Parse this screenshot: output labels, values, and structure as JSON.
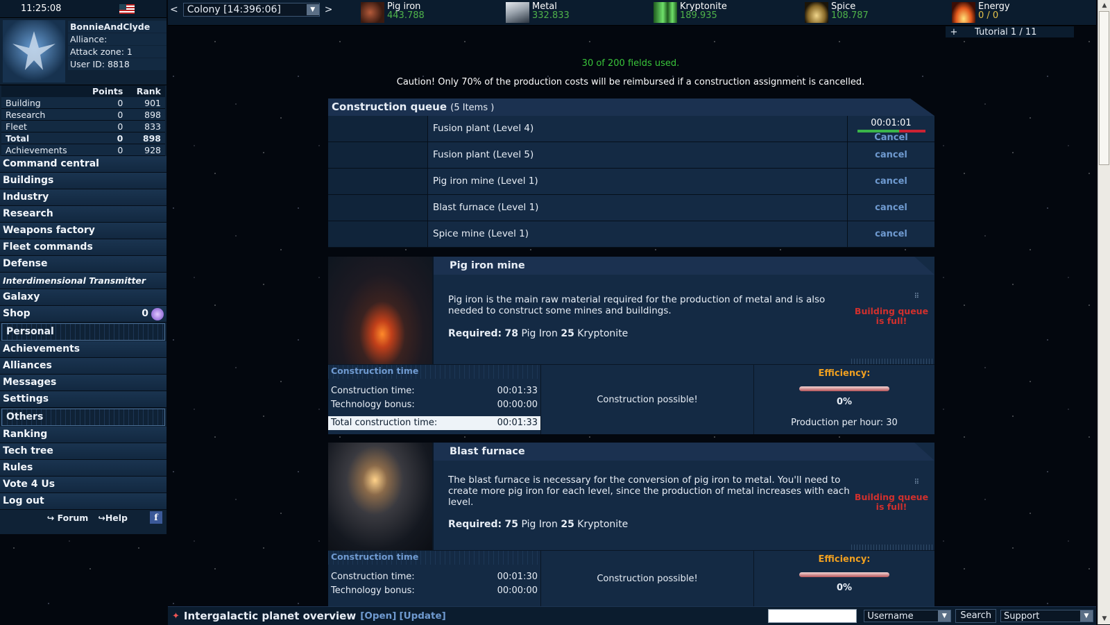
{
  "clock": "11:25:08",
  "player": {
    "name": "BonnieAndClyde",
    "alliance": "Alliance:",
    "attack_zone": "Attack zone: 1",
    "user_id": "User ID: 8818"
  },
  "stats": {
    "headers": [
      "Points",
      "Rank"
    ],
    "rows": [
      {
        "label": "Building",
        "points": "0",
        "rank": "901"
      },
      {
        "label": "Research",
        "points": "0",
        "rank": "898"
      },
      {
        "label": "Fleet",
        "points": "0",
        "rank": "833"
      },
      {
        "label": "Total",
        "points": "0",
        "rank": "898"
      },
      {
        "label": "Achievements",
        "points": "0",
        "rank": "928"
      }
    ]
  },
  "nav": {
    "main": [
      "Command central",
      "Buildings",
      "Industry",
      "Research",
      "Weapons factory",
      "Fleet commands",
      "Defense",
      "Interdimensional Transmitter",
      "Galaxy",
      "Shop"
    ],
    "shop_count": "0",
    "personal_label": "Personal",
    "personal": [
      "Achievements",
      "Alliances",
      "Messages",
      "Settings"
    ],
    "others_label": "Others",
    "others": [
      "Ranking",
      "Tech tree",
      "Rules",
      "Vote 4 Us",
      "Log out"
    ],
    "forum": "↪ Forum",
    "help": "↪Help",
    "facebook": "f"
  },
  "topbar": {
    "prev": "<",
    "next": ">",
    "colony": "Colony [14:396:06]",
    "resources": [
      {
        "name": "Pig iron",
        "value": "443.788",
        "icon": "pig-iron-icon"
      },
      {
        "name": "Metal",
        "value": "332.833",
        "icon": "metal-icon"
      },
      {
        "name": "Kryptonite",
        "value": "189.935",
        "icon": "kryptonite-icon"
      },
      {
        "name": "Spice",
        "value": "108.787",
        "icon": "spice-icon"
      },
      {
        "name": "Energy",
        "value": "0 / 0",
        "icon": "energy-icon"
      }
    ],
    "tutorial_plus": "+",
    "tutorial": "Tutorial 1 / 11"
  },
  "fields_used": "30 of 200 fields used.",
  "caution": "Caution! Only 70% of the production costs will be reimbursed if a construction assignment is cancelled.",
  "queue": {
    "title": "Construction queue",
    "count": "(5 Items )",
    "timer": "00:01:01",
    "progress": 0.62,
    "items": [
      {
        "name": "Fusion plant (Level 4)",
        "action": "Cancel"
      },
      {
        "name": "Fusion plant (Level 5)",
        "action": "cancel"
      },
      {
        "name": "Pig iron mine (Level 1)",
        "action": "cancel"
      },
      {
        "name": "Blast furnace (Level 1)",
        "action": "cancel"
      },
      {
        "name": "Spice mine (Level 1)",
        "action": "cancel"
      }
    ]
  },
  "buildings": [
    {
      "title": "Pig iron mine",
      "desc": "Pig iron is the main raw material required for the production of metal and is also needed to construct some mines and buildings.",
      "req_label": "Required:",
      "req_pig": "78",
      "req_pig_unit": "Pig Iron",
      "req_kry": "25",
      "req_kry_unit": "Kryptonite",
      "full": "Building queue is full!",
      "ct_header": "Construction time",
      "ct_label": "Construction time:",
      "ct_value": "00:01:33",
      "tb_label": "Technology bonus:",
      "tb_value": "00:00:00",
      "total_label": "Total construction time:",
      "total_value": "00:01:33",
      "possible": "Construction possible!",
      "eff_label": "Efficiency:",
      "eff_pct": "0%",
      "pph": "Production per hour: 30"
    },
    {
      "title": "Blast furnace",
      "desc": "The blast furnace is necessary for the conversion of pig iron to metal. You'll need to create more pig iron for each level, since the production of metal increases with each level.",
      "req_label": "Required:",
      "req_pig": "75",
      "req_pig_unit": "Pig Iron",
      "req_kry": "25",
      "req_kry_unit": "Kryptonite",
      "full": "Building queue is full!",
      "ct_header": "Construction time",
      "ct_label": "Construction time:",
      "ct_value": "00:01:30",
      "tb_label": "Technology bonus:",
      "tb_value": "00:00:00",
      "possible": "Construction possible!",
      "eff_label": "Efficiency:",
      "eff_pct": "0%"
    }
  ],
  "bottombar": {
    "title": "Intergalactic planet overview",
    "open": "Open",
    "update": "Update",
    "username_select": "Username",
    "search_btn": "Search",
    "support_select": "Support"
  }
}
